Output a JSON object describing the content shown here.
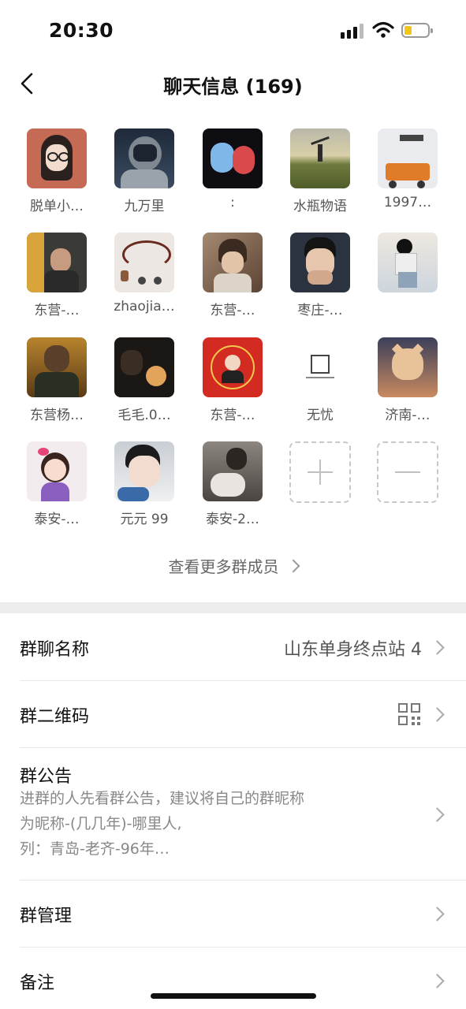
{
  "status_bar": {
    "time": "20:30"
  },
  "nav": {
    "title": "聊天信息 (169)"
  },
  "members": [
    {
      "name": "脱单小…"
    },
    {
      "name": "九万里"
    },
    {
      "name": ":"
    },
    {
      "name": "水瓶物语"
    },
    {
      "name": "1997…"
    },
    {
      "name": "东营-…"
    },
    {
      "name": "zhaojia…"
    },
    {
      "name": "东营-…"
    },
    {
      "name": "枣庄-…"
    },
    {
      "name": ""
    },
    {
      "name": "东营杨…"
    },
    {
      "name": "毛毛.0…"
    },
    {
      "name": "东营-…"
    },
    {
      "name": "无忧"
    },
    {
      "name": "济南-…"
    },
    {
      "name": "泰安-…"
    },
    {
      "name": "元元 99"
    },
    {
      "name": "泰安-2…"
    }
  ],
  "more_members_label": "查看更多群成员",
  "settings": {
    "group_name_label": "群聊名称",
    "group_name_value": "山东单身终点站 4",
    "qr_label": "群二维码",
    "notice_label": "群公告",
    "notice_lines": [
      "进群的人先看群公告，建议将自己的群昵称",
      "为昵称-(几几年)-哪里人,",
      "列：青岛-老齐-96年…"
    ],
    "manage_label": "群管理",
    "remark_label": "备注"
  },
  "colors": {
    "accent_battery": "#f2c51a",
    "background": "#ffffff",
    "section_band": "#ededed"
  }
}
